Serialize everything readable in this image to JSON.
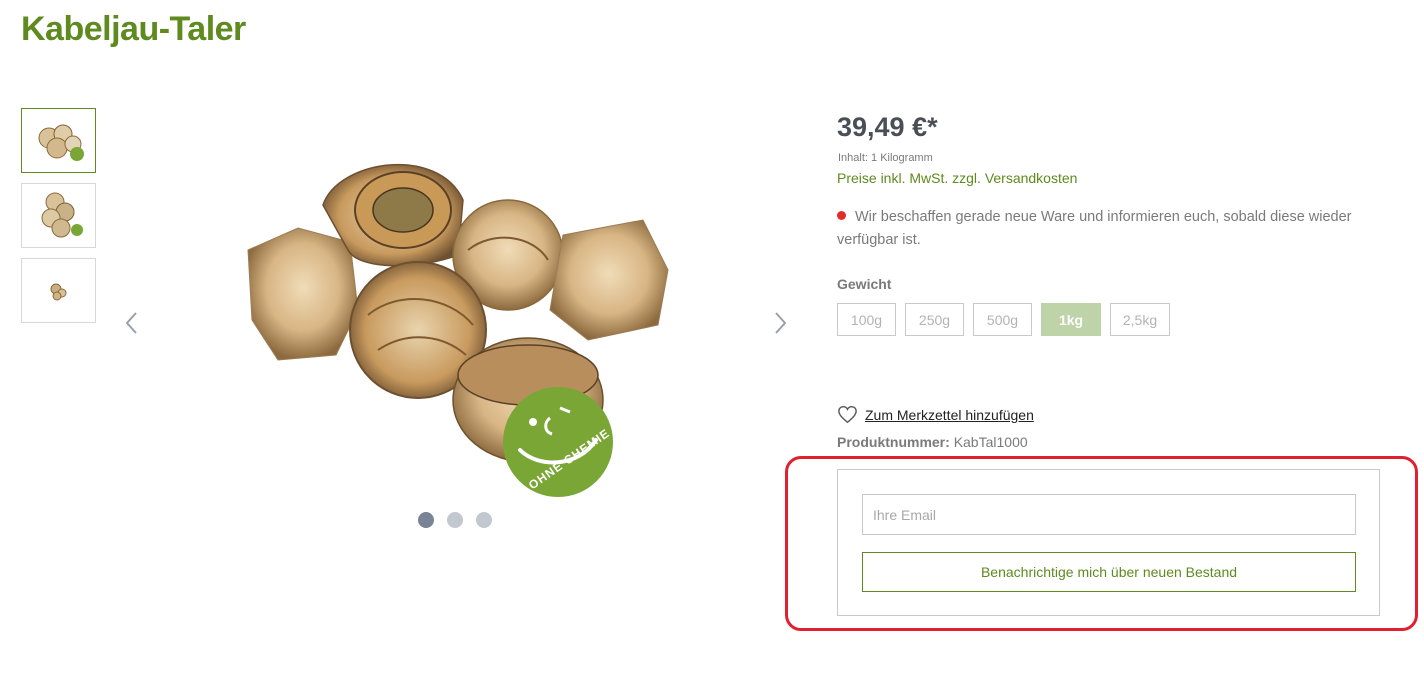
{
  "product": {
    "title": "Kabeljau-Taler",
    "image_badge": "OHNE CHEMIE"
  },
  "gallery": {
    "thumbnails": [
      {
        "name": "thumbnail-1",
        "active": true
      },
      {
        "name": "thumbnail-2",
        "active": false
      },
      {
        "name": "thumbnail-3",
        "active": false
      }
    ],
    "prev_icon": "chevron-left-icon",
    "next_icon": "chevron-right-icon",
    "dots_active_index": 0
  },
  "buybox": {
    "price": "39,49 €*",
    "content_unit": "Inhalt: 1 Kilogramm",
    "tax_link": "Preise inkl. MwSt. zzgl. Versandkosten",
    "stock_message": "Wir beschaffen gerade neue Ware und informieren euch, sobald diese wieder verfügbar ist.",
    "weight_label": "Gewicht",
    "variants": [
      "100g",
      "250g",
      "500g",
      "1kg",
      "2,5kg"
    ],
    "selected_variant": "1kg",
    "wishlist_label": "Zum Merkzettel hinzufügen",
    "product_number_label": "Produktnummer:",
    "product_number_value": "KabTal1000"
  },
  "notify": {
    "email_placeholder": "Ihre Email",
    "button_label": "Benachrichtige mich über neuen Bestand"
  },
  "colors": {
    "brand_green": "#5f8a1f",
    "selected_variant_bg": "#bfd3a8",
    "stock_dot": "#e52a2a",
    "highlight_frame": "#e0202e"
  }
}
